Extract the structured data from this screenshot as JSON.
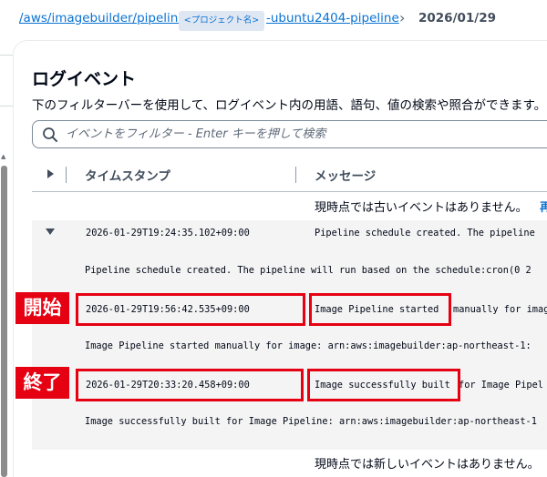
{
  "breadcrumb": {
    "path_prefix": "/aws/imagebuilder/pipeline/",
    "project_badge": "<プロジェクト名>",
    "path_suffix": "-ubuntu2404-pipeline",
    "separator": "›",
    "date": "2026/01/29"
  },
  "page": {
    "title": "ログイベント",
    "description": "下のフィルターバーを使用して、ログイベント内の用語、語句、値の検索や照合ができます。"
  },
  "search": {
    "placeholder": "イベントをフィルター - Enter キーを押して検索",
    "value": "",
    "icon": "search-icon"
  },
  "table": {
    "columns": [
      "タイムスタンプ",
      "メッセージ"
    ],
    "older_notice": "現時点では古いイベントはありません。",
    "older_link": "再",
    "newer_notice": "現時点では新しいイベントはありません。"
  },
  "event": {
    "timestamp": "2026-01-29T19:24:35.102+09:00",
    "message_preview": "Pipeline schedule created. The pipeline",
    "message_full": "Pipeline schedule created. The pipeline will run based on the schedule:cron(0 2",
    "details": [
      {
        "timestamp": "2026-01-29T19:56:42.535+09:00",
        "message_head": "Image Pipeline started",
        "message_tail": " manually for imag",
        "full": "Image Pipeline started manually for image: arn:aws:imagebuilder:ap-northeast-1:"
      },
      {
        "timestamp": "2026-01-29T20:33:20.458+09:00",
        "message_head": "Image successfully built",
        "message_tail": " for Image Pipel",
        "full": "Image successfully built for Image Pipeline: arn:aws:imagebuilder:ap-northeast-1"
      }
    ]
  },
  "annotations": {
    "start_label": "開始",
    "end_label": "終了",
    "color": "#e50012"
  },
  "colors": {
    "link": "#0972d3",
    "text": "#000716",
    "expanded_row_bg": "#f4f4f4"
  }
}
